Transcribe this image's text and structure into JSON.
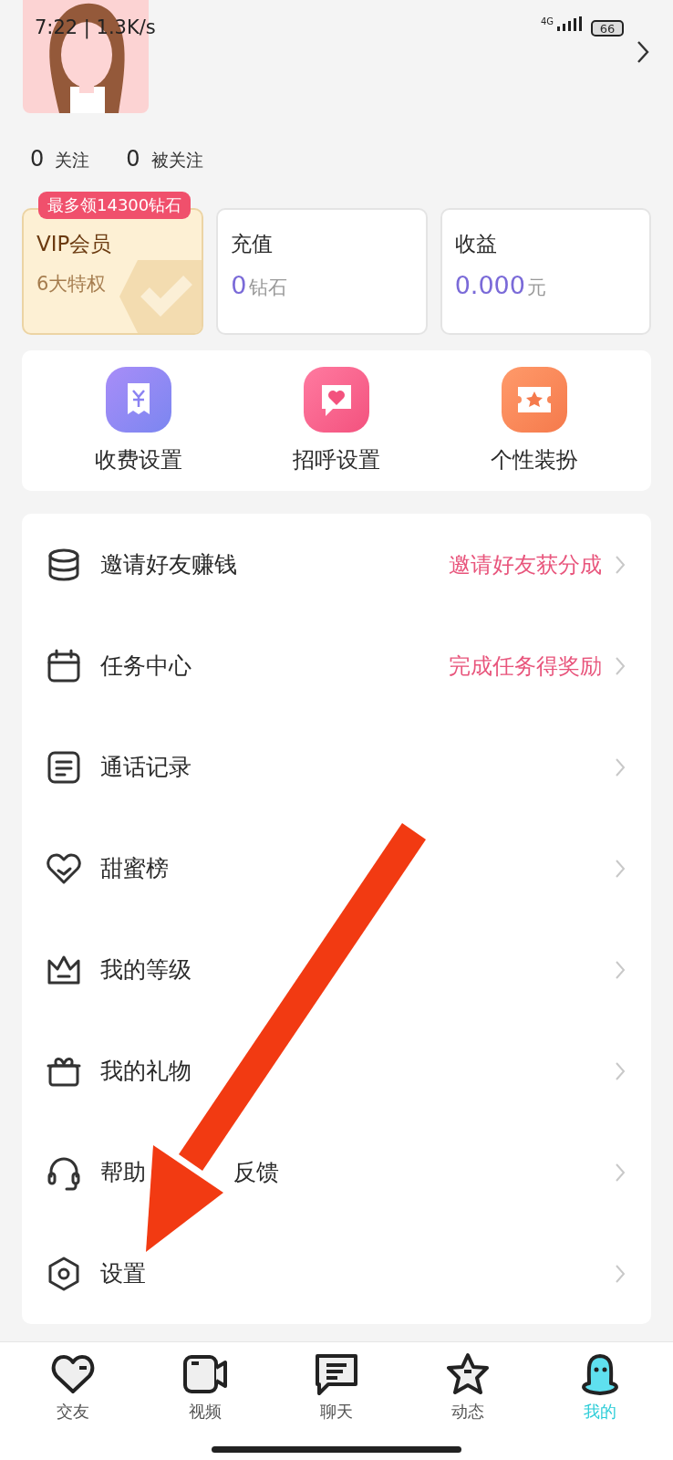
{
  "status_bar": {
    "time": "7:22 | 1.3K/s",
    "network": "4G",
    "battery": "66"
  },
  "follow_stats": [
    {
      "count": "0",
      "label": "关注"
    },
    {
      "count": "0",
      "label": "被关注"
    }
  ],
  "cards": [
    {
      "kind": "vip",
      "badge": "最多领14300钻石",
      "title": "VIP会员",
      "subtitle": "6大特权"
    },
    {
      "kind": "balance",
      "title": "充值",
      "value": "0",
      "unit": "钻石"
    },
    {
      "kind": "balance",
      "title": "收益",
      "value": "0.000",
      "unit": "元"
    }
  ],
  "quick_actions": [
    {
      "kind": "fee",
      "label": "收费设置"
    },
    {
      "kind": "greeting",
      "label": "招呼设置"
    },
    {
      "kind": "outfit",
      "label": "个性装扮"
    }
  ],
  "menu": [
    {
      "kind": "coins",
      "label": "邀请好友赚钱",
      "hint": "邀请好友获分成"
    },
    {
      "kind": "calendar",
      "label": "任务中心",
      "hint": "完成任务得奖励"
    },
    {
      "kind": "note",
      "label": "通话记录"
    },
    {
      "kind": "heart",
      "label": "甜蜜榜"
    },
    {
      "kind": "crown",
      "label": "我的等级"
    },
    {
      "kind": "gift",
      "label": "我的礼物"
    },
    {
      "kind": "headset",
      "label": "帮助",
      "label_continued": "反馈"
    },
    {
      "kind": "settings",
      "label": "设置"
    }
  ],
  "annotation": {
    "kind": "arrow"
  },
  "tabs": [
    {
      "kind": "heart",
      "label": "交友",
      "selected": false
    },
    {
      "kind": "video",
      "label": "视频",
      "selected": false
    },
    {
      "kind": "chat",
      "label": "聊天",
      "selected": false
    },
    {
      "kind": "star",
      "label": "动态",
      "selected": false
    },
    {
      "kind": "person",
      "label": "我的",
      "selected": true
    }
  ]
}
